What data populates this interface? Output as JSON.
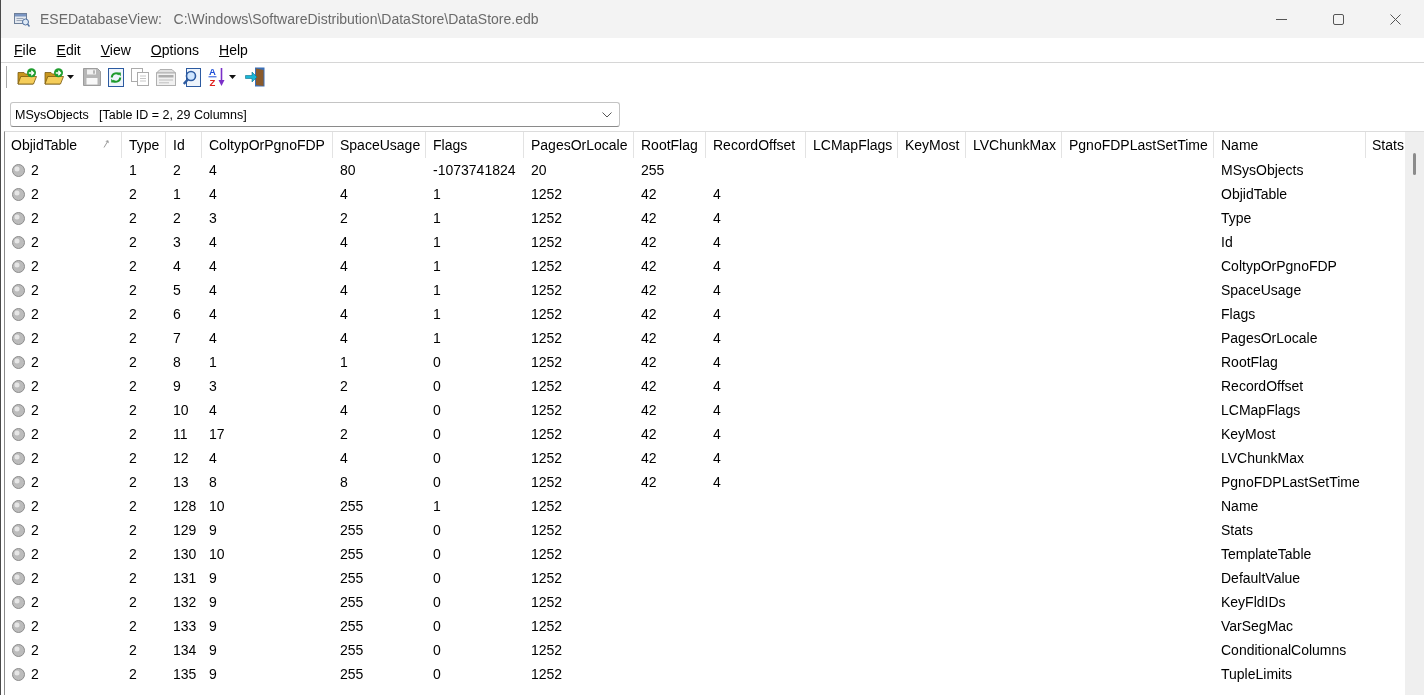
{
  "window": {
    "title": "ESEDatabaseView:   C:\\Windows\\SoftwareDistribution\\DataStore\\DataStore.edb"
  },
  "menu": [
    "File",
    "Edit",
    "View",
    "Options",
    "Help"
  ],
  "toolbar": [
    {
      "kind": "open",
      "disabled": false,
      "dropdown": false
    },
    {
      "kind": "open",
      "disabled": false,
      "dropdown": true
    },
    {
      "kind": "save",
      "disabled": true,
      "dropdown": false
    },
    {
      "kind": "refresh",
      "disabled": false,
      "dropdown": false
    },
    {
      "kind": "copy",
      "disabled": true,
      "dropdown": false
    },
    {
      "kind": "properties",
      "disabled": true,
      "dropdown": false
    },
    {
      "kind": "find",
      "disabled": false,
      "dropdown": false
    },
    {
      "kind": "sort",
      "disabled": false,
      "dropdown": true,
      "letters": [
        "A",
        "Z"
      ]
    },
    {
      "kind": "exit",
      "disabled": false,
      "dropdown": false
    }
  ],
  "table_select": {
    "value": "MSysObjects   [Table ID = 2, 29 Columns]"
  },
  "table": {
    "columns": [
      {
        "label": "ObjidTable",
        "sorted": true
      },
      {
        "label": "Type",
        "sorted": false
      },
      {
        "label": "Id",
        "sorted": false
      },
      {
        "label": "ColtypOrPgnoFDP",
        "sorted": false
      },
      {
        "label": "SpaceUsage",
        "sorted": false
      },
      {
        "label": "Flags",
        "sorted": false
      },
      {
        "label": "PagesOrLocale",
        "sorted": false
      },
      {
        "label": "RootFlag",
        "sorted": false
      },
      {
        "label": "RecordOffset",
        "sorted": false
      },
      {
        "label": "LCMapFlags",
        "sorted": false
      },
      {
        "label": "KeyMost",
        "sorted": false
      },
      {
        "label": "LVChunkMax",
        "sorted": false
      },
      {
        "label": "PgnoFDPLastSetTime",
        "sorted": false
      },
      {
        "label": "Name",
        "sorted": false
      },
      {
        "label": "Stats",
        "sorted": false
      }
    ],
    "rows": [
      {
        "cells": [
          "2",
          "1",
          "2",
          "4",
          "80",
          "-1073741824",
          "20",
          "255"
        ],
        "name": "MSysObjects"
      },
      {
        "cells": [
          "2",
          "2",
          "1",
          "4",
          "4",
          "1",
          "1252",
          "42",
          "4"
        ],
        "name": "ObjidTable"
      },
      {
        "cells": [
          "2",
          "2",
          "2",
          "3",
          "2",
          "1",
          "1252",
          "42",
          "4"
        ],
        "name": "Type"
      },
      {
        "cells": [
          "2",
          "2",
          "3",
          "4",
          "4",
          "1",
          "1252",
          "42",
          "4"
        ],
        "name": "Id"
      },
      {
        "cells": [
          "2",
          "2",
          "4",
          "4",
          "4",
          "1",
          "1252",
          "42",
          "4"
        ],
        "name": "ColtypOrPgnoFDP"
      },
      {
        "cells": [
          "2",
          "2",
          "5",
          "4",
          "4",
          "1",
          "1252",
          "42",
          "4"
        ],
        "name": "SpaceUsage"
      },
      {
        "cells": [
          "2",
          "2",
          "6",
          "4",
          "4",
          "1",
          "1252",
          "42",
          "4"
        ],
        "name": "Flags"
      },
      {
        "cells": [
          "2",
          "2",
          "7",
          "4",
          "4",
          "1",
          "1252",
          "42",
          "4"
        ],
        "name": "PagesOrLocale"
      },
      {
        "cells": [
          "2",
          "2",
          "8",
          "1",
          "1",
          "0",
          "1252",
          "42",
          "4"
        ],
        "name": "RootFlag"
      },
      {
        "cells": [
          "2",
          "2",
          "9",
          "3",
          "2",
          "0",
          "1252",
          "42",
          "4"
        ],
        "name": "RecordOffset"
      },
      {
        "cells": [
          "2",
          "2",
          "10",
          "4",
          "4",
          "0",
          "1252",
          "42",
          "4"
        ],
        "name": "LCMapFlags"
      },
      {
        "cells": [
          "2",
          "2",
          "11",
          "17",
          "2",
          "0",
          "1252",
          "42",
          "4"
        ],
        "name": "KeyMost"
      },
      {
        "cells": [
          "2",
          "2",
          "12",
          "4",
          "4",
          "0",
          "1252",
          "42",
          "4"
        ],
        "name": "LVChunkMax"
      },
      {
        "cells": [
          "2",
          "2",
          "13",
          "8",
          "8",
          "0",
          "1252",
          "42",
          "4"
        ],
        "name": "PgnoFDPLastSetTime"
      },
      {
        "cells": [
          "2",
          "2",
          "128",
          "10",
          "255",
          "1",
          "1252"
        ],
        "name": "Name"
      },
      {
        "cells": [
          "2",
          "2",
          "129",
          "9",
          "255",
          "0",
          "1252"
        ],
        "name": "Stats"
      },
      {
        "cells": [
          "2",
          "2",
          "130",
          "10",
          "255",
          "0",
          "1252"
        ],
        "name": "TemplateTable"
      },
      {
        "cells": [
          "2",
          "2",
          "131",
          "9",
          "255",
          "0",
          "1252"
        ],
        "name": "DefaultValue"
      },
      {
        "cells": [
          "2",
          "2",
          "132",
          "9",
          "255",
          "0",
          "1252"
        ],
        "name": "KeyFldIDs"
      },
      {
        "cells": [
          "2",
          "2",
          "133",
          "9",
          "255",
          "0",
          "1252"
        ],
        "name": "VarSegMac"
      },
      {
        "cells": [
          "2",
          "2",
          "134",
          "9",
          "255",
          "0",
          "1252"
        ],
        "name": "ConditionalColumns"
      },
      {
        "cells": [
          "2",
          "2",
          "135",
          "9",
          "255",
          "0",
          "1252"
        ],
        "name": "TupleLimits"
      }
    ]
  }
}
